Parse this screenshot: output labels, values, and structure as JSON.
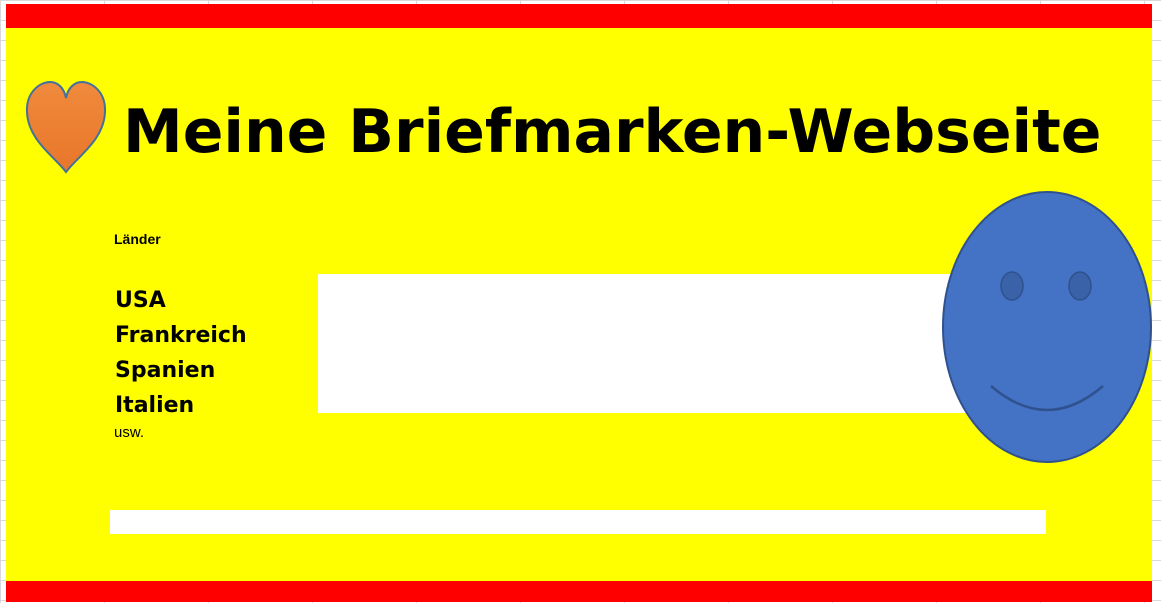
{
  "page": {
    "title": "Meine Briefmarken-Webseite"
  },
  "countries": {
    "label": "Länder",
    "items": [
      "USA",
      "Frankreich",
      "Spanien",
      "Italien"
    ],
    "more": "usw."
  },
  "icons": {
    "heart": "heart-icon",
    "smiley": "smiley-face-icon"
  },
  "colors": {
    "background": "#ffff00",
    "band": "#ff0000",
    "heart": "#ed7d31",
    "smiley": "#4472c4",
    "title_text": "#000000"
  }
}
